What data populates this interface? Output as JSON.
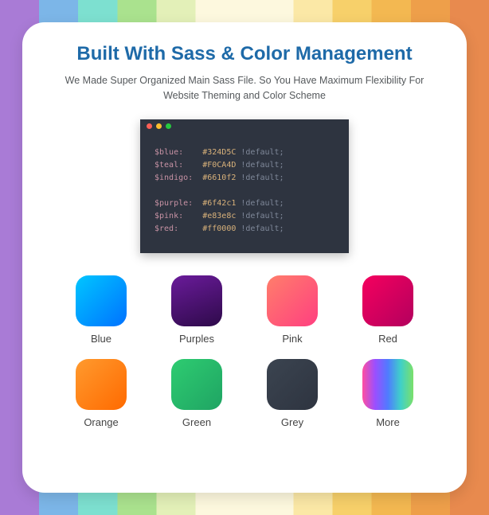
{
  "title": "Built With Sass & Color Management",
  "subtitle": "We Made Super Organized Main Sass File. So You Have Maximum Flexibility For Website Theming and Color Scheme",
  "code": {
    "lines": [
      {
        "var": "$blue:",
        "pad": "$blue:   ",
        "hex": "#324D5C",
        "imp": " !default;"
      },
      {
        "var": "$teal:",
        "pad": "$teal:   ",
        "hex": "#F0CA4D",
        "imp": " !default;"
      },
      {
        "var": "$indigo:",
        "pad": "$indigo: ",
        "hex": "#6610f2",
        "imp": " !default;"
      },
      {
        "blank": " "
      },
      {
        "var": "$purple:",
        "pad": "$purple: ",
        "hex": "#6f42c1",
        "imp": " !default;"
      },
      {
        "var": "$pink:",
        "pad": "$pink:   ",
        "hex": "#e83e8c",
        "imp": " !default;"
      },
      {
        "var": "$red:",
        "pad": "$red:    ",
        "hex": "#ff0000",
        "imp": " !default;"
      }
    ]
  },
  "swatches": [
    {
      "label": "Blue",
      "class": "c-blue"
    },
    {
      "label": "Purples",
      "class": "c-purples"
    },
    {
      "label": "Pink",
      "class": "c-pink"
    },
    {
      "label": "Red",
      "class": "c-red"
    },
    {
      "label": "Orange",
      "class": "c-orange"
    },
    {
      "label": "Green",
      "class": "c-green"
    },
    {
      "label": "Grey",
      "class": "c-grey"
    },
    {
      "label": "More",
      "class": "c-more"
    }
  ]
}
